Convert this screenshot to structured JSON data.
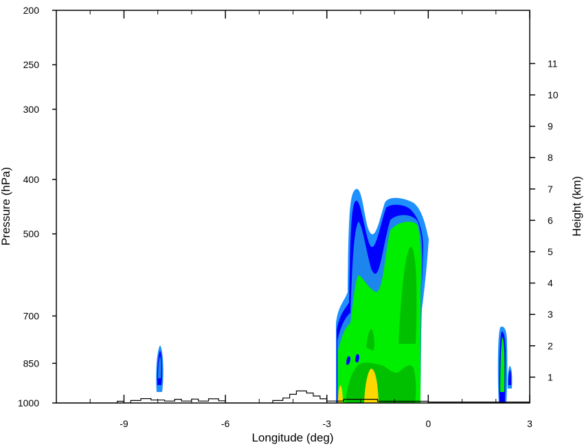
{
  "chart_data": {
    "type": "contour",
    "xlabel": "Longitude (deg)",
    "ylabel": "Pressure (hPa)",
    "y2label": "Height (km)",
    "xlim": [
      -11.0,
      3.0
    ],
    "ylim": [
      1000,
      200
    ],
    "y_scale": "log",
    "x_ticks": [
      -9,
      -6,
      -3,
      0,
      3
    ],
    "x_tick_labels": [
      "-9",
      "-6",
      "-3",
      "0",
      "3"
    ],
    "y_ticks": [
      1000,
      850,
      700,
      500,
      400,
      300,
      250,
      200
    ],
    "y_tick_labels": [
      "1000",
      "850",
      "700",
      "500",
      "400",
      "300",
      "250",
      "200"
    ],
    "y2_ticks": [
      1,
      2,
      3,
      4,
      5,
      6,
      7,
      8,
      9,
      10,
      11
    ],
    "y2_tick_labels": [
      "1",
      "2",
      "3",
      "4",
      "5",
      "6",
      "7",
      "8",
      "9",
      "10",
      "11"
    ],
    "fill_colors": [
      "#1e90ff",
      "#0000ff",
      "#1c86ee",
      "#00ee00",
      "#00c000",
      "#ffd700"
    ],
    "terrain_pressure": [
      [
        -11.0,
        1000
      ],
      [
        -9.2,
        1000
      ],
      [
        -9.2,
        993
      ],
      [
        -9.0,
        993
      ],
      [
        -9.0,
        1000
      ],
      [
        -8.8,
        1000
      ],
      [
        -8.8,
        990
      ],
      [
        -8.5,
        990
      ],
      [
        -8.5,
        982
      ],
      [
        -8.2,
        982
      ],
      [
        -8.2,
        988
      ],
      [
        -7.8,
        988
      ],
      [
        -7.8,
        992
      ],
      [
        -7.5,
        992
      ],
      [
        -7.5,
        985
      ],
      [
        -7.3,
        985
      ],
      [
        -7.3,
        992
      ],
      [
        -7.0,
        992
      ],
      [
        -7.0,
        984
      ],
      [
        -6.8,
        984
      ],
      [
        -6.8,
        992
      ],
      [
        -6.5,
        992
      ],
      [
        -6.5,
        983
      ],
      [
        -6.2,
        983
      ],
      [
        -6.2,
        991
      ],
      [
        -6.0,
        991
      ],
      [
        -6.0,
        1000
      ],
      [
        -4.6,
        1000
      ],
      [
        -4.6,
        990
      ],
      [
        -4.3,
        990
      ],
      [
        -4.3,
        980
      ],
      [
        -4.1,
        980
      ],
      [
        -4.1,
        965
      ],
      [
        -3.9,
        965
      ],
      [
        -3.9,
        952
      ],
      [
        -3.6,
        952
      ],
      [
        -3.6,
        960
      ],
      [
        -3.4,
        960
      ],
      [
        -3.4,
        972
      ],
      [
        -3.2,
        972
      ],
      [
        -3.2,
        983
      ],
      [
        -3.0,
        983
      ],
      [
        -3.0,
        992
      ],
      [
        -2.5,
        992
      ],
      [
        -2.5,
        985
      ],
      [
        -1.5,
        985
      ],
      [
        -1.5,
        993
      ],
      [
        0.0,
        993
      ],
      [
        0.0,
        996
      ],
      [
        3.0,
        996
      ]
    ]
  }
}
